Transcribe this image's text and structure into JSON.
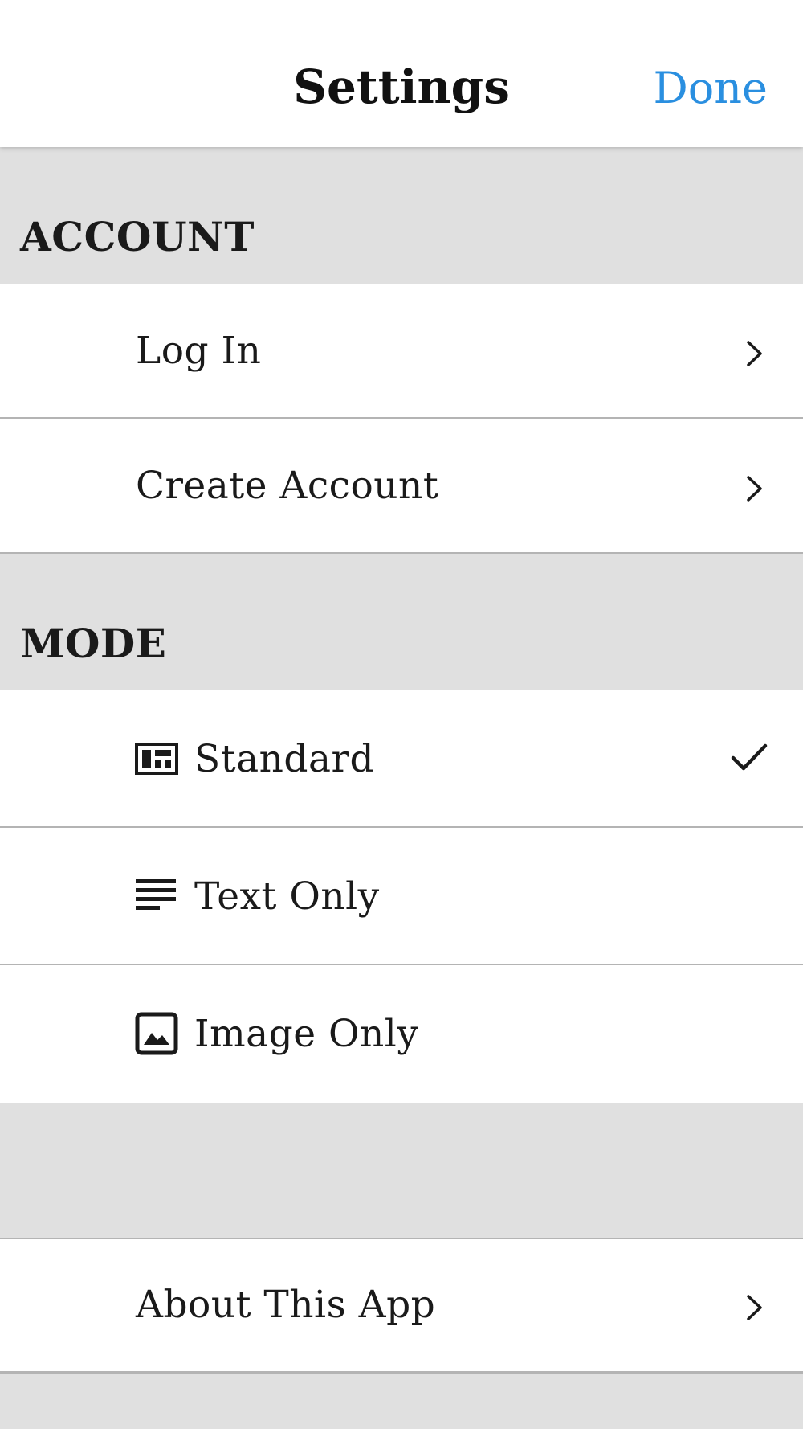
{
  "nav": {
    "title": "Settings",
    "done_label": "Done"
  },
  "sections": {
    "account": {
      "header": "ACCOUNT",
      "items": [
        {
          "label": "Log In",
          "accessory": "chevron-right-icon"
        },
        {
          "label": "Create Account",
          "accessory": "chevron-right-icon"
        }
      ]
    },
    "mode": {
      "header": "MODE",
      "items": [
        {
          "label": "Standard",
          "icon": "standard-layout-icon",
          "selected": true
        },
        {
          "label": "Text Only",
          "icon": "text-lines-icon",
          "selected": false
        },
        {
          "label": "Image Only",
          "icon": "image-icon",
          "selected": false
        }
      ]
    },
    "other": {
      "header": "",
      "items": [
        {
          "label": "About This App",
          "accessory": "chevron-right-icon"
        }
      ]
    }
  },
  "colors": {
    "accent": "#2a8fe0",
    "section_background": "#e0e0e0",
    "row_background": "#ffffff",
    "separator": "#b4b4b4"
  }
}
